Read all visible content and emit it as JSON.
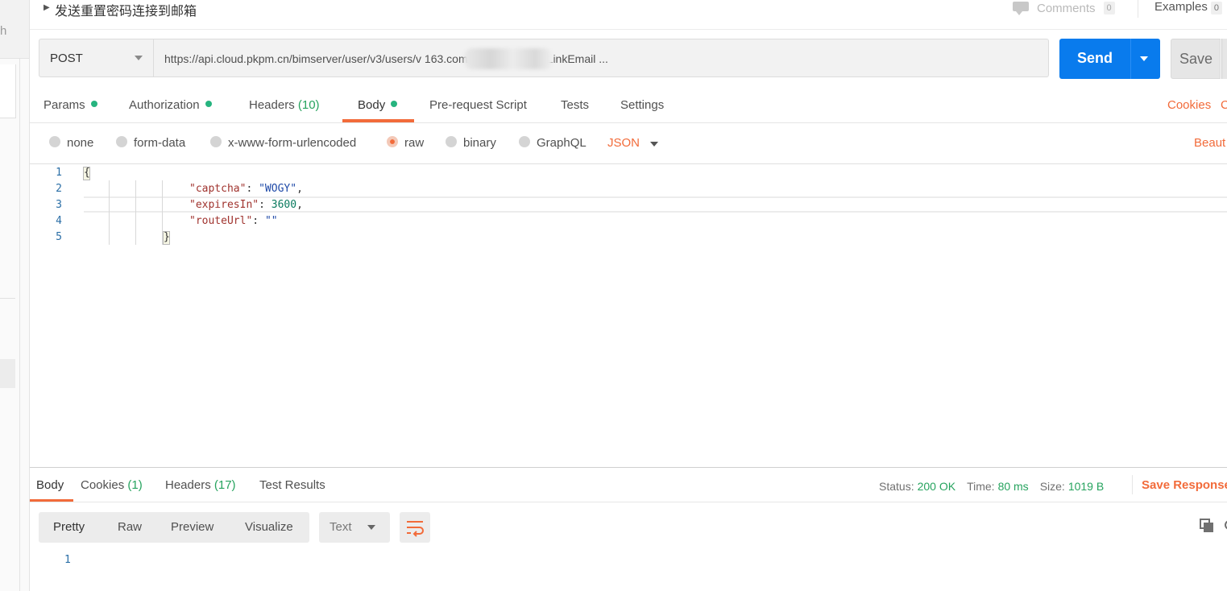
{
  "request": {
    "name": "发送重置密码连接到邮箱",
    "method": "POST",
    "url": "https://api.cloud.pkpm.cn/bimserver/user/v3/users/v                  163.com/sendResetPwdLinkEmail ...",
    "send_label": "Send",
    "save_label": "Save"
  },
  "header": {
    "comments_label": "Comments",
    "comments_count": "0",
    "examples_label": "Examples",
    "examples_count": "0"
  },
  "sidebar": {
    "clipped_text": "h"
  },
  "request_tabs": {
    "params": "Params",
    "authorization": "Authorization",
    "headers": "Headers",
    "headers_count": "(10)",
    "body": "Body",
    "prerequest": "Pre-request Script",
    "tests": "Tests",
    "settings": "Settings",
    "cookies": "Cookies",
    "code": "C"
  },
  "body_types": {
    "none": "none",
    "form_data": "form-data",
    "urlencoded": "x-www-form-urlencoded",
    "raw": "raw",
    "binary": "binary",
    "graphql": "GraphQL",
    "selected": "raw",
    "language": "JSON",
    "beautify": "Beaut"
  },
  "editor": {
    "line_numbers": [
      "1",
      "2",
      "3",
      "4",
      "5"
    ],
    "open_brace": "{",
    "close_brace": "}",
    "fields": [
      {
        "key": "\"captcha\"",
        "value": "\"WOGY\"",
        "trail": ","
      },
      {
        "key": "\"expiresIn\"",
        "value": "3600",
        "trail": ","
      },
      {
        "key": "\"routeUrl\"",
        "value": "\"\"",
        "trail": ""
      }
    ]
  },
  "response_tabs": {
    "body": "Body",
    "cookies": "Cookies",
    "cookies_count": "(1)",
    "headers": "Headers",
    "headers_count": "(17)",
    "test_results": "Test Results"
  },
  "response_stats": {
    "status_label": "Status:",
    "status_value": "200 OK",
    "time_label": "Time:",
    "time_value": "80 ms",
    "size_label": "Size:",
    "size_value": "1019 B",
    "save_response": "Save Response"
  },
  "response_toolbar": {
    "pretty": "Pretty",
    "raw": "Raw",
    "preview": "Preview",
    "visualize": "Visualize",
    "format": "Text"
  },
  "response_body": {
    "line_numbers": [
      "1"
    ]
  },
  "colors": {
    "accent": "#f26b3a",
    "send_blue": "#097bed",
    "success_green": "#26a35e"
  },
  "icons": [
    "caret-right-icon",
    "comment-icon",
    "chevron-down-icon",
    "wrap-lines-icon",
    "copy-icon",
    "search-icon"
  ]
}
